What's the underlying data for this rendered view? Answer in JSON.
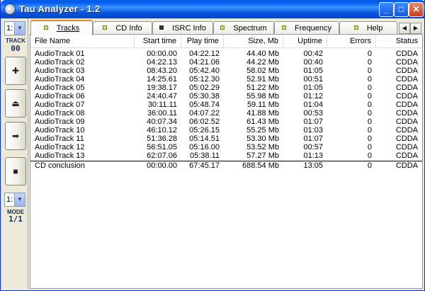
{
  "window": {
    "title": "Tau Analyzer - 1.2"
  },
  "controls": {
    "track_select": "1:",
    "track_label": "TRACK",
    "track_number": "00",
    "mode_select": "1:",
    "mode_label": "MODE",
    "mode_value": "1/1"
  },
  "tabs": [
    {
      "label": "Tracks",
      "mnemonic": "T"
    },
    {
      "label": "CD Info",
      "mnemonic": "C"
    },
    {
      "label": "ISRC Info",
      "mnemonic": "I"
    },
    {
      "label": "Spectrum",
      "mnemonic": "S"
    },
    {
      "label": "Frequency",
      "mnemonic": "F"
    },
    {
      "label": "Help",
      "mnemonic": "H"
    }
  ],
  "table": {
    "columns": [
      "File Name",
      "Start time",
      "Play time",
      "Size, Mb",
      "Uptime",
      "Errors",
      "Status"
    ],
    "rows": [
      [
        "AudioTrack 01",
        "00:00.00",
        "04:22.12",
        "44.40 Mb",
        "00:42",
        "0",
        "CDDA"
      ],
      [
        "AudioTrack 02",
        "04:22.13",
        "04:21.06",
        "44.22 Mb",
        "00:40",
        "0",
        "CDDA"
      ],
      [
        "AudioTrack 03",
        "08:43.20",
        "05:42.40",
        "58.02 Mb",
        "01:05",
        "0",
        "CDDA"
      ],
      [
        "AudioTrack 04",
        "14:25.61",
        "05:12.30",
        "52.91 Mb",
        "00:51",
        "0",
        "CDDA"
      ],
      [
        "AudioTrack 05",
        "19:38.17",
        "05:02.29",
        "51.22 Mb",
        "01:05",
        "0",
        "CDDA"
      ],
      [
        "AudioTrack 06",
        "24:40.47",
        "05:30.38",
        "55.98 Mb",
        "01:12",
        "0",
        "CDDA"
      ],
      [
        "AudioTrack 07",
        "30:11.11",
        "05:48.74",
        "59.11 Mb",
        "01:04",
        "0",
        "CDDA"
      ],
      [
        "AudioTrack 08",
        "36:00.11",
        "04:07.22",
        "41.88 Mb",
        "00:53",
        "0",
        "CDDA"
      ],
      [
        "AudioTrack 09",
        "40:07.34",
        "06:02.52",
        "61.43 Mb",
        "01:07",
        "0",
        "CDDA"
      ],
      [
        "AudioTrack 10",
        "46:10.12",
        "05:26.15",
        "55.25 Mb",
        "01:03",
        "0",
        "CDDA"
      ],
      [
        "AudioTrack 11",
        "51:36.28",
        "05:14.51",
        "53.30 Mb",
        "01:07",
        "0",
        "CDDA"
      ],
      [
        "AudioTrack 12",
        "56:51.05",
        "05:16.00",
        "53.52 Mb",
        "00:57",
        "0",
        "CDDA"
      ],
      [
        "AudioTrack 13",
        "62:07.06",
        "05:38.11",
        "57.27 Mb",
        "01:13",
        "0",
        "CDDA"
      ]
    ],
    "summary": [
      "CD conclusion",
      "00:00.00",
      "67:45.17",
      "688.54 Mb",
      "13:05",
      "0",
      "CDDA"
    ]
  }
}
